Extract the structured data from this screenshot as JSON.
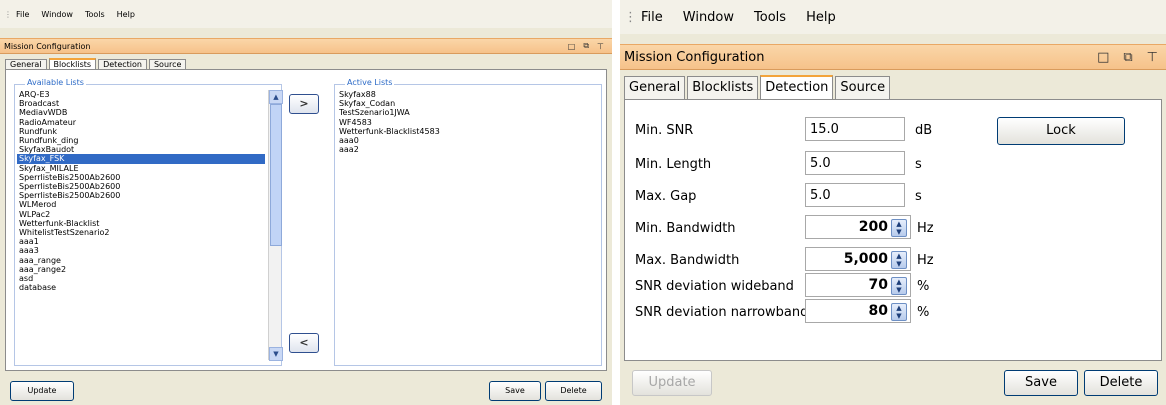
{
  "menu": [
    "File",
    "Window",
    "Tools",
    "Help"
  ],
  "window_title": "Mission Configuration",
  "tabs": [
    "General",
    "Blocklists",
    "Detection",
    "Source"
  ],
  "left": {
    "active_tab": "Blocklists",
    "available_legend": "Available Lists",
    "active_legend": "Active Lists",
    "available_items": [
      "ARQ-E3",
      "Broadcast",
      "MediavWDB",
      "RadioAmateur",
      "Rundfunk",
      "Rundfunk_ding",
      "SkyfaxBaudot",
      "Skyfax_FSK",
      "Skyfax_MILALE",
      "SperrlisteBis2500Ab2600",
      "SperrlisteBis2500Ab2600",
      "SperrlisteBis2500Ab2600",
      "WLMerod",
      "WLPac2",
      "Wetterfunk-Blacklist",
      "WhitelistTestSzenario2",
      "aaa1",
      "aaa3",
      "aaa_range",
      "aaa_range2",
      "asd",
      "database"
    ],
    "selected_index": 7,
    "active_items": [
      "Skyfax88",
      "Skyfax_Codan",
      "TestSzenario1JWA",
      "WF4583",
      "Wetterfunk-Blacklist4583",
      "aaa0",
      "aaa2"
    ],
    "add_arrow": ">",
    "remove_arrow": "<",
    "update_label": "Update",
    "save_label": "Save",
    "delete_label": "Delete"
  },
  "right": {
    "active_tab": "Detection",
    "fields": [
      {
        "label": "Min. SNR",
        "value": "15.0",
        "unit": "dB"
      },
      {
        "label": "Min. Length",
        "value": "5.0",
        "unit": "s"
      },
      {
        "label": "Max. Gap",
        "value": "5.0",
        "unit": "s"
      }
    ],
    "spinners": [
      {
        "label": "Min. Bandwidth",
        "value": "200",
        "unit": "Hz"
      },
      {
        "label": "Max. Bandwidth",
        "value": "5,000",
        "unit": "Hz"
      },
      {
        "label": "SNR deviation wideband",
        "value": "70",
        "unit": "%"
      },
      {
        "label": "SNR deviation narrowband",
        "value": "80",
        "unit": "%"
      }
    ],
    "lock_label": "Lock",
    "update_label": "Update",
    "save_label": "Save",
    "delete_label": "Delete"
  }
}
